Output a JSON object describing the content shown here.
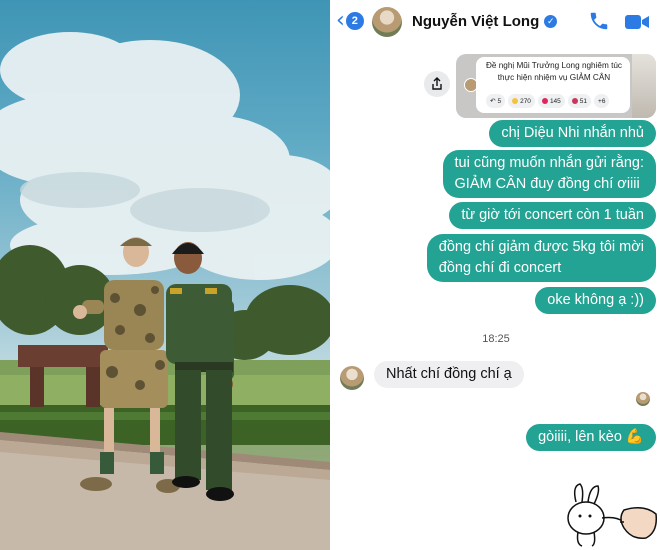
{
  "header": {
    "back_count": "2",
    "contact_name": "Nguyễn Việt Long",
    "icons": [
      "chevron-left-icon",
      "verified-icon",
      "phone-icon",
      "video-call-icon"
    ],
    "accent_color": "#2c7be5"
  },
  "shared_post": {
    "text": "Đề nghị Mũi Trưởng Long nghiêm túc thực hiện nhiệm vụ GIẢM CÂN",
    "reactions": [
      {
        "icon": "reply-icon",
        "count": "5"
      },
      {
        "icon": "haha-icon",
        "count": "270"
      },
      {
        "icon": "heart-icon",
        "count": "145"
      },
      {
        "icon": "love-icon",
        "count": "51"
      },
      {
        "icon": "more-icon",
        "count": "+6"
      }
    ],
    "share_icon": "share-icon"
  },
  "messages": {
    "out1": "chị Diệu Nhi nhắn nhủ",
    "out2_line1": "tui cũng muốn nhắn gửi rằng:",
    "out2_line2": "GIẢM CÂN đuy đồng chí ơiiii",
    "out3": "từ giờ tới concert còn 1 tuần",
    "out4_line1": "đồng chí giảm được 5kg tôi mời",
    "out4_line2": "đồng chí đi concert",
    "out5": "oke không ạ :))",
    "time": "18:25",
    "in1": "Nhất chí đồng chí ạ",
    "out6": "gòiiii, lên kèo 💪"
  },
  "colors": {
    "outgoing_bubble": "#23a393",
    "incoming_bubble": "#efeff1"
  }
}
